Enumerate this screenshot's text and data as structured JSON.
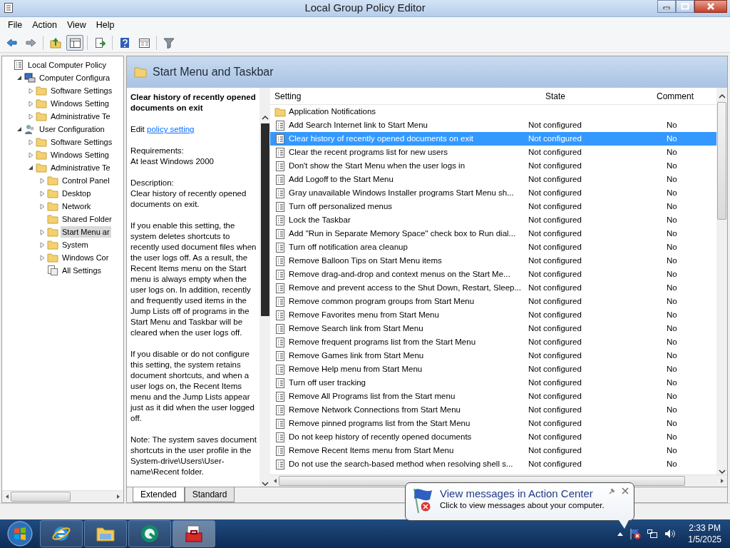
{
  "window": {
    "title": "Local Group Policy Editor"
  },
  "menu": [
    "File",
    "Action",
    "View",
    "Help"
  ],
  "toolbar": [
    {
      "kind": "back",
      "pressed": false
    },
    {
      "kind": "forward",
      "pressed": false
    },
    {
      "kind": "sep"
    },
    {
      "kind": "up",
      "pressed": false
    },
    {
      "kind": "tree",
      "pressed": true
    },
    {
      "kind": "sep"
    },
    {
      "kind": "export",
      "pressed": false
    },
    {
      "kind": "sep"
    },
    {
      "kind": "help",
      "pressed": false
    },
    {
      "kind": "properties",
      "pressed": false
    },
    {
      "kind": "sep"
    },
    {
      "kind": "filter",
      "pressed": false
    }
  ],
  "tree": [
    {
      "label": "Local Computer Policy",
      "kind": "policy",
      "selected": false,
      "children": [
        {
          "label": "Computer Configura",
          "kind": "computer",
          "expanded": true,
          "selected": false,
          "children": [
            {
              "label": "Software Settings",
              "kind": "folder",
              "expanded": false,
              "selected": false
            },
            {
              "label": "Windows Setting",
              "kind": "folder",
              "expanded": false,
              "selected": false
            },
            {
              "label": "Administrative Te",
              "kind": "folder",
              "expanded": false,
              "selected": false
            }
          ]
        },
        {
          "label": "User Configuration",
          "kind": "user",
          "expanded": true,
          "selected": false,
          "children": [
            {
              "label": "Software Settings",
              "kind": "folder",
              "expanded": false,
              "selected": false
            },
            {
              "label": "Windows Setting",
              "kind": "folder",
              "expanded": false,
              "selected": false
            },
            {
              "label": "Administrative Te",
              "kind": "folder",
              "expanded": true,
              "selected": false,
              "children": [
                {
                  "label": "Control Panel",
                  "kind": "folder",
                  "expanded": false,
                  "selected": false
                },
                {
                  "label": "Desktop",
                  "kind": "folder",
                  "expanded": false,
                  "selected": false
                },
                {
                  "label": "Network",
                  "kind": "folder",
                  "expanded": false,
                  "selected": false
                },
                {
                  "label": "Shared Folder",
                  "kind": "folder",
                  "selected": false
                },
                {
                  "label": "Start Menu ar",
                  "kind": "folder",
                  "expanded": false,
                  "selected": true
                },
                {
                  "label": "System",
                  "kind": "folder",
                  "expanded": false,
                  "selected": false
                },
                {
                  "label": "Windows Cor",
                  "kind": "folder",
                  "expanded": false,
                  "selected": false
                },
                {
                  "label": "All Settings",
                  "kind": "settings",
                  "selected": false
                }
              ]
            }
          ]
        }
      ]
    }
  ],
  "pane": {
    "title": "Start Menu and Taskbar"
  },
  "description": {
    "title": "Clear history of recently opened documents on exit",
    "edit_prefix": "Edit",
    "edit_link": "policy setting",
    "requirements_label": "Requirements:",
    "requirements": "At least Windows 2000",
    "description_label": "Description:",
    "paragraphs": [
      "Clear history of recently opened documents on exit.",
      "If you enable this setting, the system deletes shortcuts to recently used document files when the user logs off. As a result, the Recent Items menu on the Start menu is always empty when the user logs on. In addition, recently and frequently used items in the Jump Lists off of programs in the Start Menu and Taskbar will be cleared when the user logs off.",
      "If you disable or do not configure this setting, the system retains document shortcuts, and when a user logs on, the Recent Items menu and the Jump Lists appear just as it did when the user logged off.",
      "Note: The system saves document shortcuts in the user profile in the System-drive\\Users\\User-name\\Recent folder."
    ]
  },
  "table": {
    "columns": [
      "Setting",
      "State",
      "Comment"
    ],
    "rows": [
      {
        "kind": "folder",
        "setting": "Application Notifications",
        "selected": false
      },
      {
        "kind": "policy",
        "setting": "Add Search Internet link to Start Menu",
        "state": "Not configured",
        "comment": "No",
        "selected": false
      },
      {
        "kind": "policy",
        "setting": "Clear history of recently opened documents on exit",
        "state": "Not configured",
        "comment": "No",
        "selected": true
      },
      {
        "kind": "policy",
        "setting": "Clear the recent programs list for new users",
        "state": "Not configured",
        "comment": "No",
        "selected": false
      },
      {
        "kind": "policy",
        "setting": "Don't show the Start Menu when the user logs in",
        "state": "Not configured",
        "comment": "No",
        "selected": false
      },
      {
        "kind": "policy",
        "setting": "Add Logoff to the Start Menu",
        "state": "Not configured",
        "comment": "No",
        "selected": false
      },
      {
        "kind": "policy",
        "setting": "Gray unavailable Windows Installer programs Start Menu sh...",
        "state": "Not configured",
        "comment": "No",
        "selected": false
      },
      {
        "kind": "policy",
        "setting": "Turn off personalized menus",
        "state": "Not configured",
        "comment": "No",
        "selected": false
      },
      {
        "kind": "policy",
        "setting": "Lock the Taskbar",
        "state": "Not configured",
        "comment": "No",
        "selected": false
      },
      {
        "kind": "policy",
        "setting": "Add \"Run in Separate Memory Space\" check box to Run dial...",
        "state": "Not configured",
        "comment": "No",
        "selected": false
      },
      {
        "kind": "policy",
        "setting": "Turn off notification area cleanup",
        "state": "Not configured",
        "comment": "No",
        "selected": false
      },
      {
        "kind": "policy",
        "setting": "Remove Balloon Tips on Start Menu items",
        "state": "Not configured",
        "comment": "No",
        "selected": false
      },
      {
        "kind": "policy",
        "setting": "Remove drag-and-drop and context menus on the Start Me...",
        "state": "Not configured",
        "comment": "No",
        "selected": false
      },
      {
        "kind": "policy",
        "setting": "Remove and prevent access to the Shut Down, Restart, Sleep...",
        "state": "Not configured",
        "comment": "No",
        "selected": false
      },
      {
        "kind": "policy",
        "setting": "Remove common program groups from Start Menu",
        "state": "Not configured",
        "comment": "No",
        "selected": false
      },
      {
        "kind": "policy",
        "setting": "Remove Favorites menu from Start Menu",
        "state": "Not configured",
        "comment": "No",
        "selected": false
      },
      {
        "kind": "policy",
        "setting": "Remove Search link from Start Menu",
        "state": "Not configured",
        "comment": "No",
        "selected": false
      },
      {
        "kind": "policy",
        "setting": "Remove frequent programs list from the Start Menu",
        "state": "Not configured",
        "comment": "No",
        "selected": false
      },
      {
        "kind": "policy",
        "setting": "Remove Games link from Start Menu",
        "state": "Not configured",
        "comment": "No",
        "selected": false
      },
      {
        "kind": "policy",
        "setting": "Remove Help menu from Start Menu",
        "state": "Not configured",
        "comment": "No",
        "selected": false
      },
      {
        "kind": "policy",
        "setting": "Turn off user tracking",
        "state": "Not configured",
        "comment": "No",
        "selected": false
      },
      {
        "kind": "policy",
        "setting": "Remove All Programs list from the Start menu",
        "state": "Not configured",
        "comment": "No",
        "selected": false
      },
      {
        "kind": "policy",
        "setting": "Remove Network Connections from Start Menu",
        "state": "Not configured",
        "comment": "No",
        "selected": false
      },
      {
        "kind": "policy",
        "setting": "Remove pinned programs list from the Start Menu",
        "state": "Not configured",
        "comment": "No",
        "selected": false
      },
      {
        "kind": "policy",
        "setting": "Do not keep history of recently opened documents",
        "state": "Not configured",
        "comment": "No",
        "selected": false
      },
      {
        "kind": "policy",
        "setting": "Remove Recent Items menu from Start Menu",
        "state": "Not configured",
        "comment": "No",
        "selected": false
      },
      {
        "kind": "policy",
        "setting": "Do not use the search-based method when resolving shell s...",
        "state": "Not configured",
        "comment": "No",
        "selected": false
      }
    ]
  },
  "tabs": [
    {
      "label": "Extended",
      "selected": true
    },
    {
      "label": "Standard",
      "selected": false
    }
  ],
  "notification": {
    "title": "View messages in Action Center",
    "text": "Click to view messages about your computer."
  },
  "taskbar": {
    "apps": [
      {
        "kind": "browser",
        "selected": false
      },
      {
        "kind": "explorer",
        "selected": false
      },
      {
        "kind": "green",
        "selected": false
      },
      {
        "kind": "toolbox",
        "selected": true
      }
    ],
    "time": "2:33 PM",
    "date": "1/5/2025"
  }
}
